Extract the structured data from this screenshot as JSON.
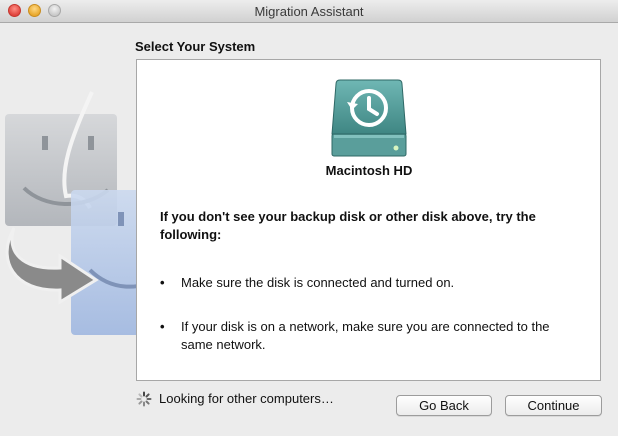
{
  "window": {
    "title": "Migration Assistant"
  },
  "page": {
    "section_title": "Select Your System"
  },
  "disk": {
    "label": "Macintosh HD",
    "icon": "time-machine-disk-icon"
  },
  "help": {
    "heading": "If you don't see your backup disk or other disk above, try the following:",
    "bullets": [
      "Make sure the disk is connected and turned on.",
      "If your disk is on a network, make sure you are connected to the same network."
    ],
    "bullet_glyph": "•"
  },
  "status": {
    "text": "Looking for other computers…"
  },
  "buttons": {
    "back_label": "Go Back",
    "continue_label": "Continue"
  },
  "colors": {
    "disk_teal": "#4e9896",
    "window_bg": "#ececec"
  }
}
